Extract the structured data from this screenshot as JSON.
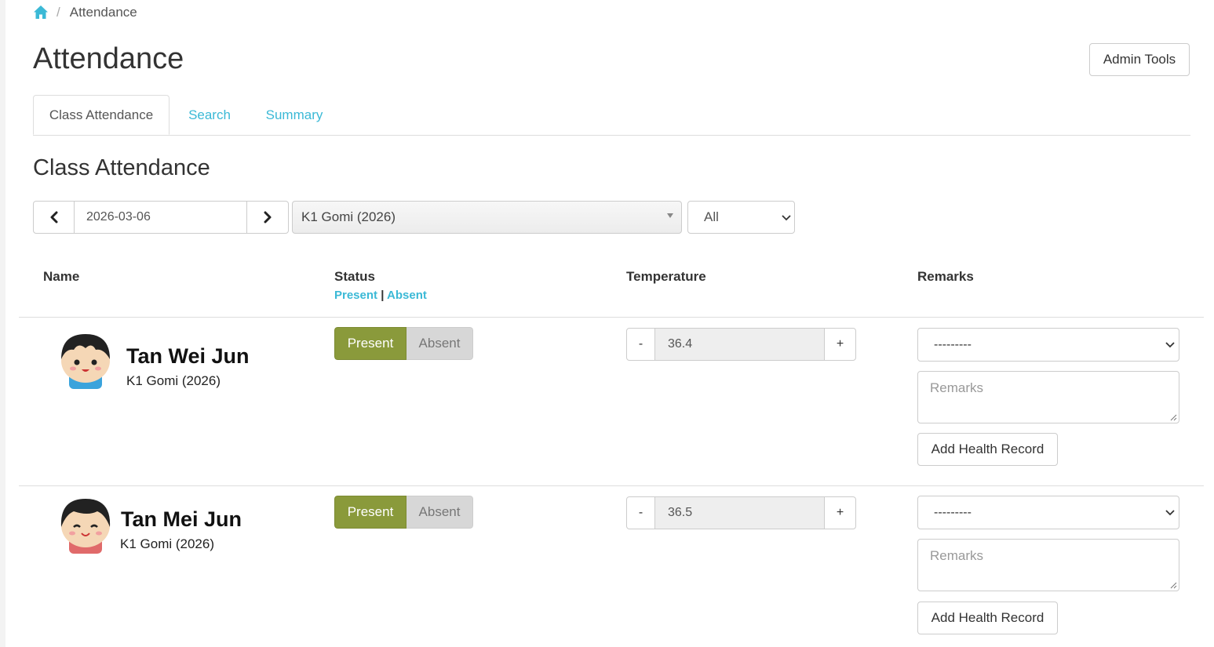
{
  "breadcrumb": {
    "home_icon": "home-icon",
    "separator": "/",
    "current": "Attendance"
  },
  "page": {
    "title": "Attendance",
    "admin_button": "Admin Tools"
  },
  "tabs": [
    {
      "label": "Class Attendance",
      "active": true
    },
    {
      "label": "Search",
      "active": false
    },
    {
      "label": "Summary",
      "active": false
    }
  ],
  "section_title": "Class Attendance",
  "controls": {
    "date": "2026-03-06",
    "prev_icon": "chevron-left-icon",
    "next_icon": "chevron-right-icon",
    "class_selected": "K1 Gomi (2026)",
    "filter_selected": "All"
  },
  "table": {
    "headers": {
      "name": "Name",
      "status": "Status",
      "temperature": "Temperature",
      "remarks": "Remarks"
    },
    "status_links": {
      "present": "Present",
      "separator": "|",
      "absent": "Absent"
    }
  },
  "students": [
    {
      "name": "Tan Wei Jun",
      "class": "K1 Gomi (2026)",
      "status_present": "Present",
      "status_absent": "Absent",
      "selected_status": "Present",
      "temp_minus": "-",
      "temperature": "36.4",
      "temp_plus": "+",
      "remark_option": "---------",
      "remarks_placeholder": "Remarks",
      "health_button": "Add Health Record",
      "avatar_shirt_color": "#3aa3dc"
    },
    {
      "name": "Tan Mei Jun",
      "class": "K1 Gomi (2026)",
      "status_present": "Present",
      "status_absent": "Absent",
      "selected_status": "Present",
      "temp_minus": "-",
      "temperature": "36.5",
      "temp_plus": "+",
      "remark_option": "---------",
      "remarks_placeholder": "Remarks",
      "health_button": "Add Health Record",
      "avatar_shirt_color": "#e06a6a"
    }
  ],
  "colors": {
    "link": "#3bb9d6",
    "present": "#8a9a3b",
    "absent": "#d7d7d7"
  }
}
